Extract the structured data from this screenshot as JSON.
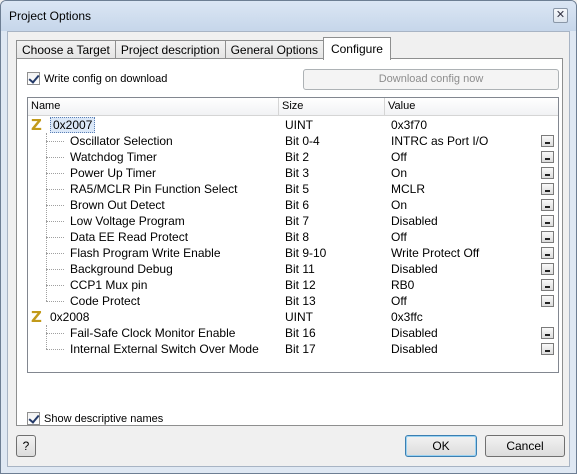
{
  "window": {
    "title": "Project Options",
    "close": "✕"
  },
  "tabs": [
    {
      "label": "Choose a Target"
    },
    {
      "label": "Project description"
    },
    {
      "label": "General Options"
    },
    {
      "label": "Configure"
    }
  ],
  "write_config": {
    "label": "Write config on download",
    "checked": true
  },
  "download_button": {
    "label": "Download config now"
  },
  "grid": {
    "columns": [
      "Name",
      "Size",
      "Value"
    ],
    "groups": [
      {
        "name": "0x2007",
        "size": "UINT",
        "value": "0x3f70",
        "rows": [
          {
            "name": "Oscillator Selection",
            "size": "Bit 0-4",
            "value": "INTRC as Port I/O"
          },
          {
            "name": "Watchdog Timer",
            "size": "Bit 2",
            "value": "Off"
          },
          {
            "name": "Power Up Timer",
            "size": "Bit 3",
            "value": "On"
          },
          {
            "name": "RA5/MCLR Pin Function Select",
            "size": "Bit 5",
            "value": "MCLR"
          },
          {
            "name": "Brown Out Detect",
            "size": "Bit 6",
            "value": "On"
          },
          {
            "name": "Low Voltage Program",
            "size": "Bit 7",
            "value": "Disabled"
          },
          {
            "name": "Data EE Read Protect",
            "size": "Bit 8",
            "value": "Off"
          },
          {
            "name": "Flash Program Write Enable",
            "size": "Bit 9-10",
            "value": "Write Protect Off"
          },
          {
            "name": "Background Debug",
            "size": "Bit 11",
            "value": "Disabled"
          },
          {
            "name": "CCP1 Mux pin",
            "size": "Bit 12",
            "value": "RB0"
          },
          {
            "name": "Code Protect",
            "size": "Bit 13",
            "value": "Off"
          }
        ]
      },
      {
        "name": "0x2008",
        "size": "UINT",
        "value": "0x3ffc",
        "rows": [
          {
            "name": "Fail-Safe Clock Monitor Enable",
            "size": "Bit 16",
            "value": "Disabled"
          },
          {
            "name": "Internal External Switch Over Mode",
            "size": "Bit 17",
            "value": "Disabled"
          }
        ]
      }
    ]
  },
  "show_names": {
    "label": "Show descriptive names",
    "checked": true
  },
  "help_button": {
    "label": "?"
  },
  "ok_button": {
    "label": "OK"
  },
  "cancel_button": {
    "label": "Cancel"
  },
  "icons": {
    "group": "Z"
  }
}
